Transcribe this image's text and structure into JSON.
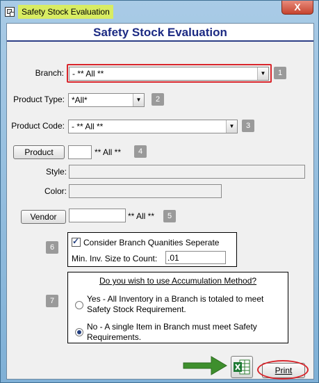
{
  "window": {
    "title": "Safety Stock Evaluation",
    "close_label": "X"
  },
  "header": {
    "title": "Safety Stock Evaluation"
  },
  "form": {
    "branch": {
      "label": "Branch:",
      "value": "- ** All **",
      "badge": "1"
    },
    "product_type": {
      "label": "Product Type:",
      "value": "*All*",
      "badge": "2"
    },
    "product_code": {
      "label": "Product Code:",
      "value": "- ** All **",
      "badge": "3"
    },
    "product": {
      "button_label": "Product",
      "value": "",
      "all_text": "** All **",
      "badge": "4"
    },
    "style": {
      "label": "Style:",
      "value": ""
    },
    "color": {
      "label": "Color:",
      "value": ""
    },
    "vendor": {
      "button_label": "Vendor",
      "value": "",
      "all_text": "** All **",
      "badge": "5"
    },
    "branch_options": {
      "badge": "6",
      "checkbox_label": "Consider Branch Quanities Seperate",
      "checked": true,
      "min_inv_label": "Min. Inv. Size to Count:",
      "min_inv_value": ".01"
    },
    "accumulation": {
      "badge": "7",
      "question": "Do you wish to use Accumulation Method?",
      "options": [
        {
          "line1": "Yes - All Inventory in a Branch is totaled to meet",
          "line2": "Safety Stock Requirement.",
          "selected": false
        },
        {
          "line1": "No - A single Item in Branch must meet Safety",
          "line2": "Requirements.",
          "selected": true
        }
      ]
    }
  },
  "actions": {
    "excel_icon": "excel-icon",
    "print_label": "Print"
  },
  "colors": {
    "header_title": "#1c2a83",
    "highlight": "#d9252b",
    "arrow": "#3e8f2d",
    "title_highlight": "#d8ec62"
  }
}
